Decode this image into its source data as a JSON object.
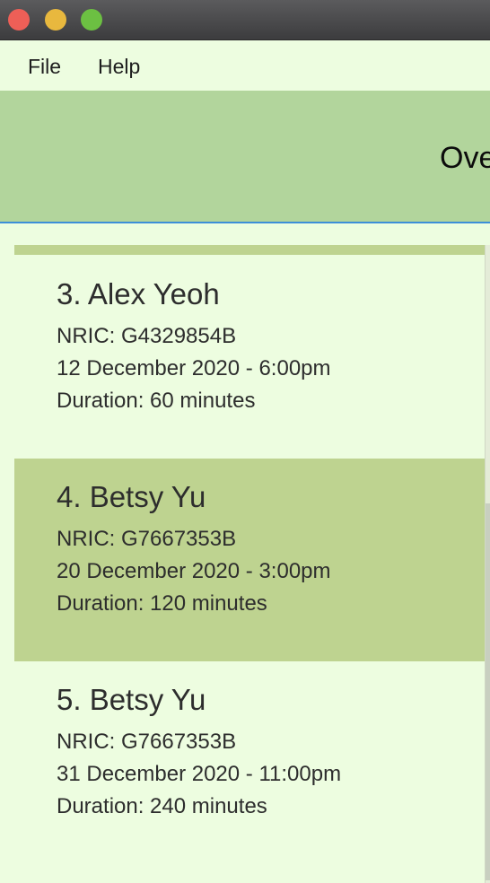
{
  "window": {
    "controls": [
      "close",
      "minimize",
      "zoom"
    ]
  },
  "menu": {
    "file_label": "File",
    "help_label": "Help"
  },
  "header": {
    "title": "Ove"
  },
  "appointments": [
    {
      "title": "3.  Alex Yeoh",
      "nric": "NRIC: G4329854B",
      "datetime": "12 December 2020 - 6:00pm",
      "duration": "Duration: 60 minutes",
      "selected": false
    },
    {
      "title": "4.  Betsy Yu",
      "nric": "NRIC: G7667353B",
      "datetime": "20 December 2020 - 3:00pm",
      "duration": "Duration: 120 minutes",
      "selected": true
    },
    {
      "title": "5.  Betsy Yu",
      "nric": "NRIC: G7667353B",
      "datetime": "31 December 2020 - 11:00pm",
      "duration": "Duration: 240 minutes",
      "selected": false
    }
  ],
  "colors": {
    "background": "#edfde0",
    "header": "#b2d59c",
    "selected_card": "#bed390",
    "header_border": "#3d8fd8"
  }
}
